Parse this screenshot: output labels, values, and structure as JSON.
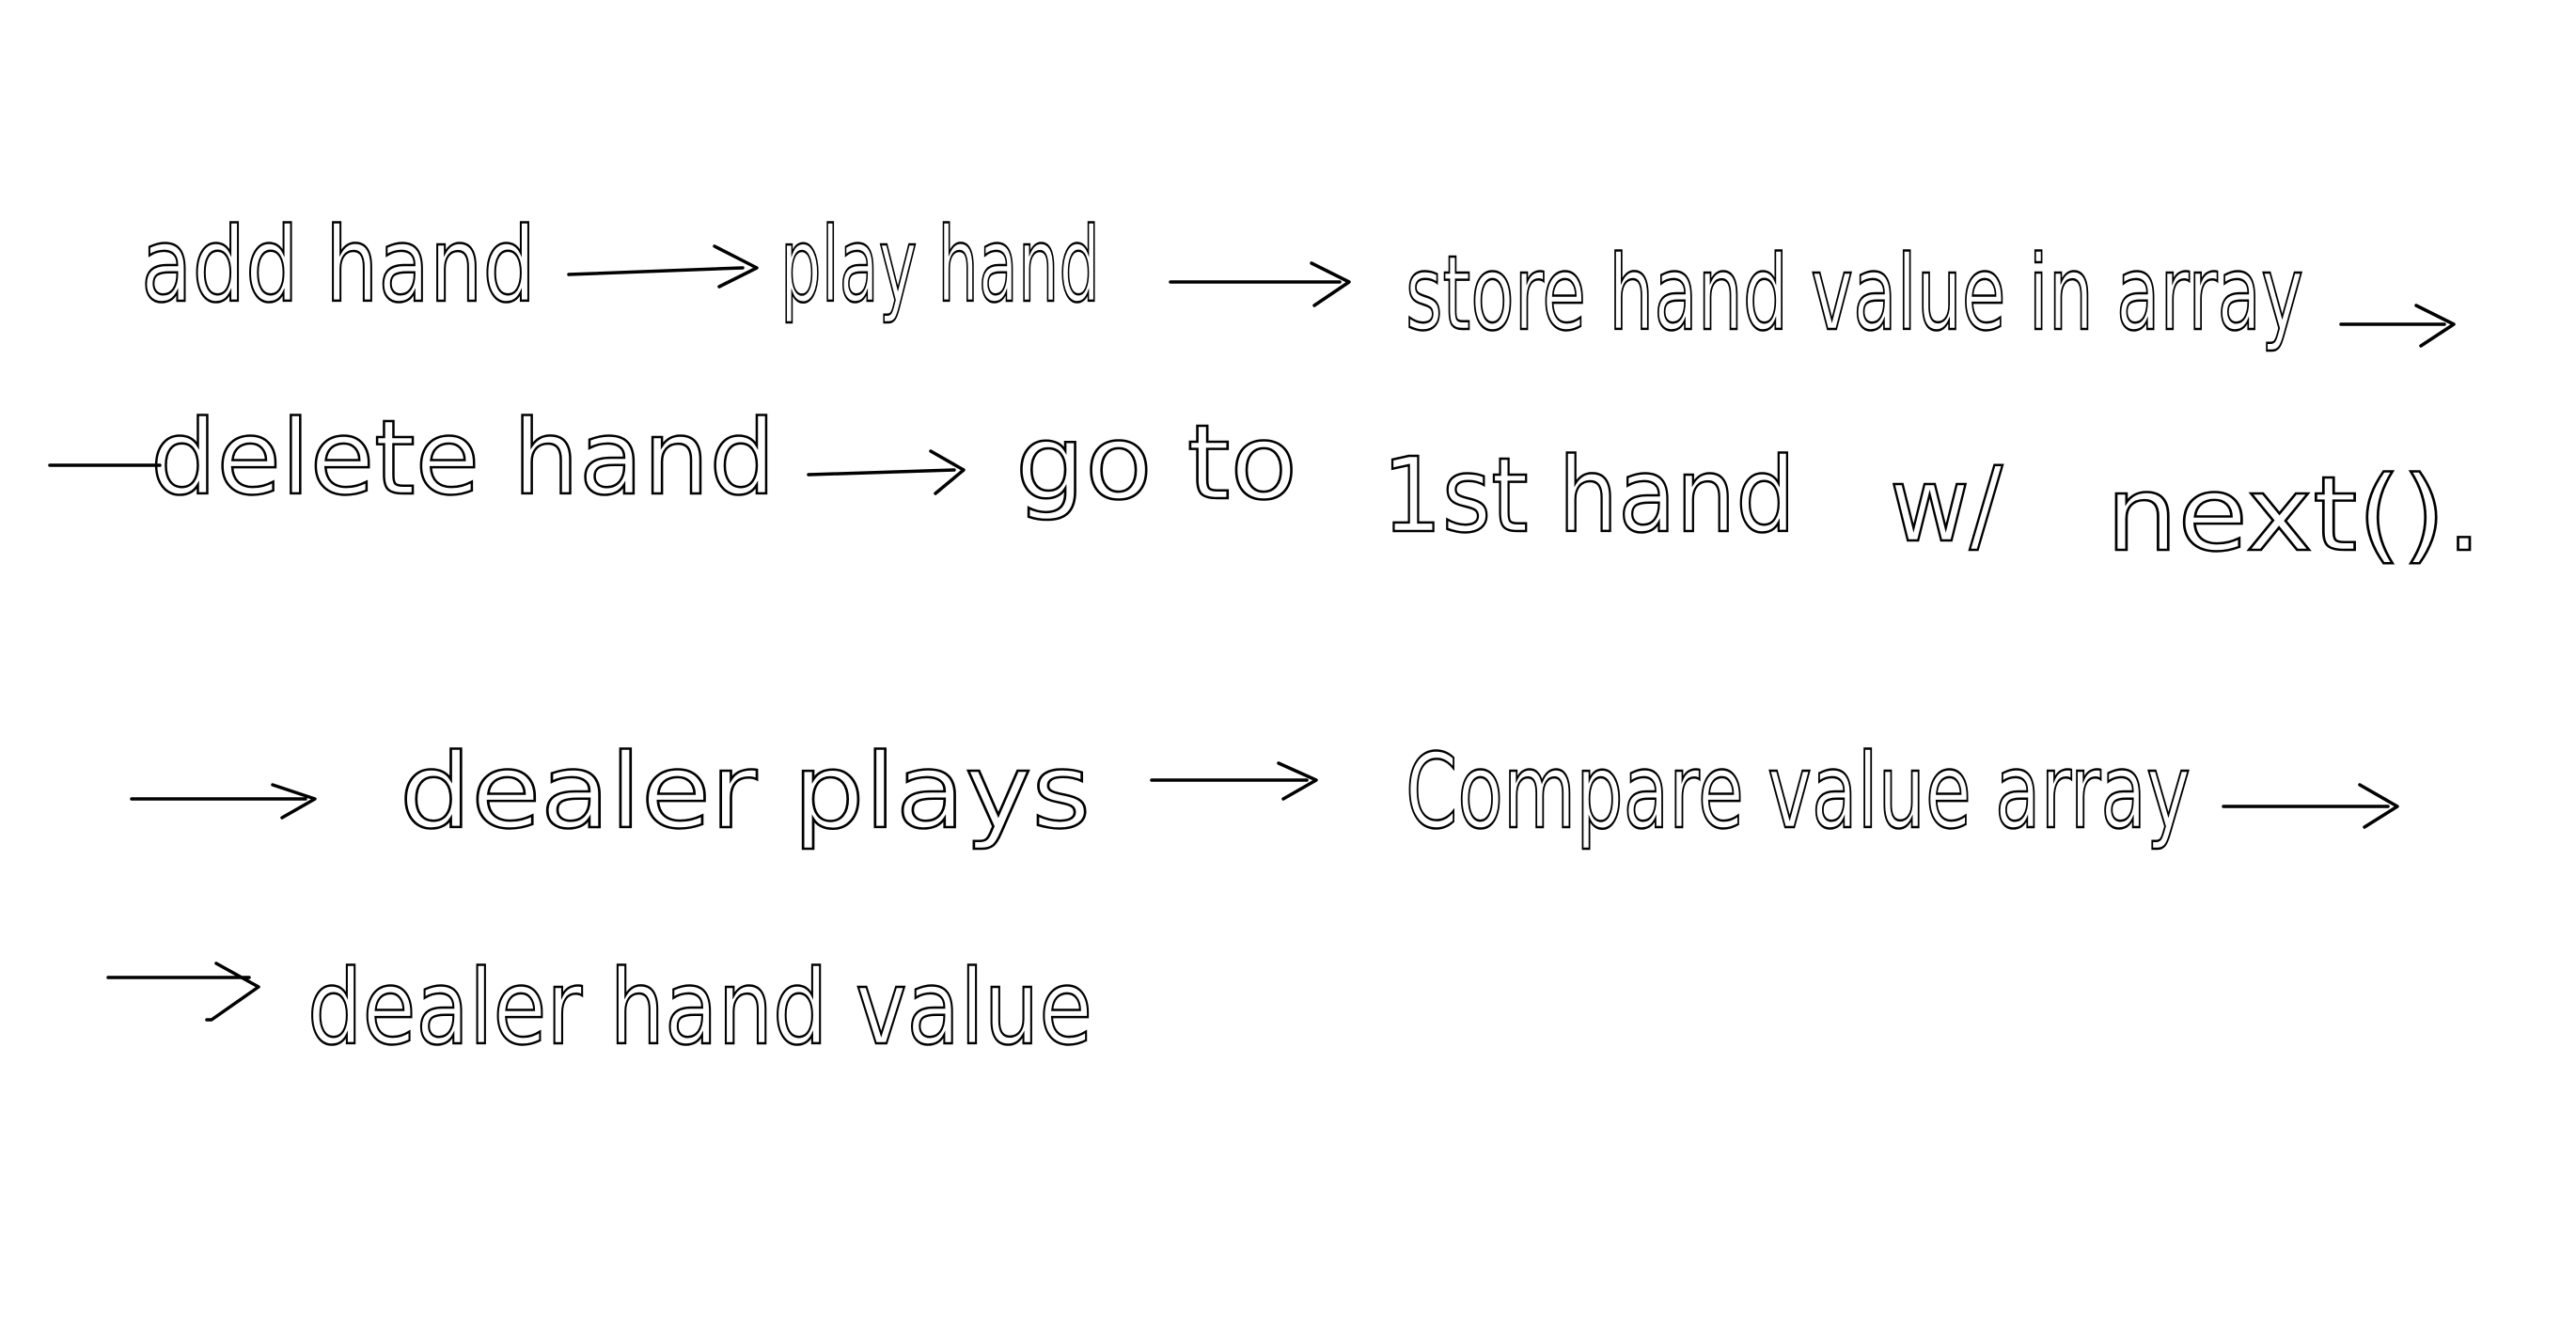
{
  "canvas": {
    "background": "#ffffff",
    "ink_color": "#000000"
  },
  "notes": {
    "line1": [
      "add hand",
      "play hand",
      "store hand value in array"
    ],
    "line2": [
      "delete hand",
      "go to",
      "1st hand",
      "w/",
      "next()."
    ],
    "line3": [
      "dealer plays",
      "Compare value array"
    ],
    "line4": [
      "dealer hand value"
    ]
  }
}
